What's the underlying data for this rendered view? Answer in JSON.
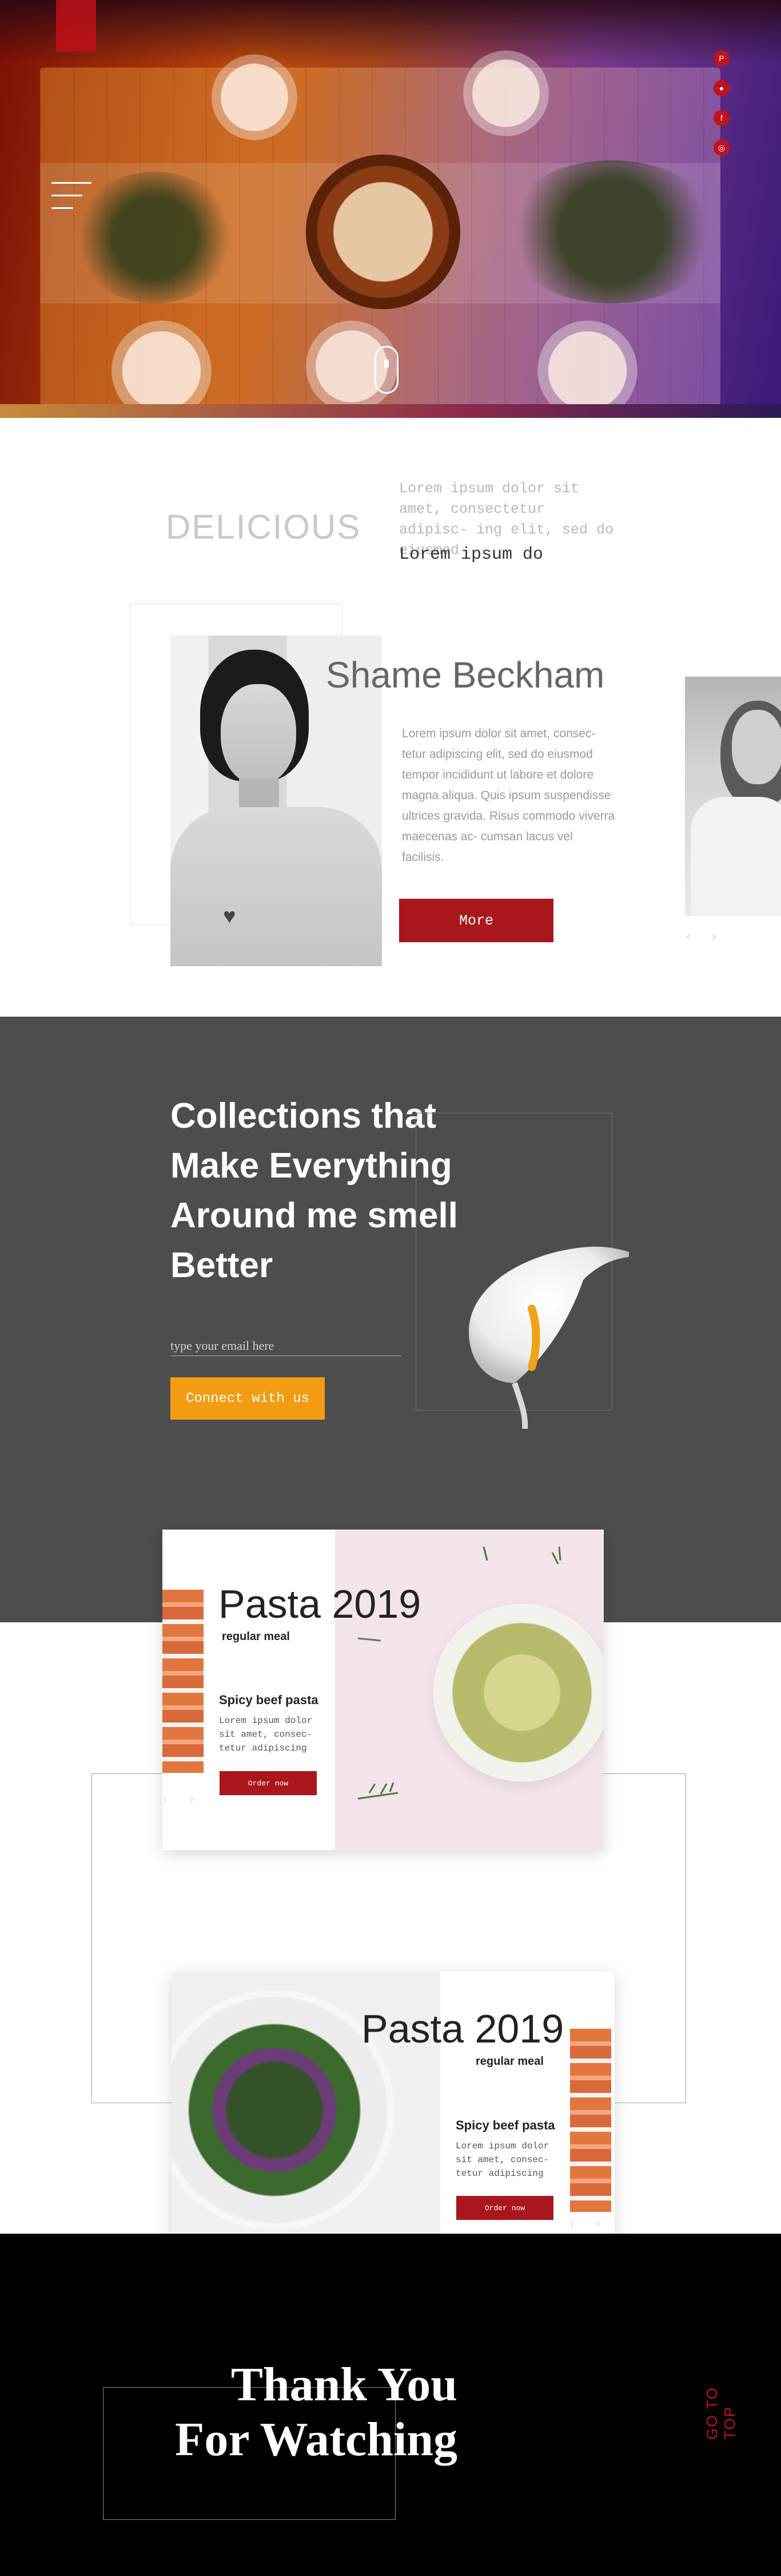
{
  "hero": {
    "social_icons": [
      "pinterest-icon",
      "dribbble-icon",
      "facebook-icon",
      "instagram-icon"
    ],
    "accent_color": "#c1131f"
  },
  "about": {
    "heading": "DELICIOUS",
    "intro_text": "Lorem ipsum dolor sit amet, consectetur adipisc- ing elit, sed do eiusmod",
    "intro_subtext": "Lorem ipsum do",
    "name": "Shame Beckham",
    "description": "Lorem ipsum dolor sit amet, consec- tetur adipiscing elit, sed do eiusmod tempor incididunt ut labore et dolore magna aliqua. Quis ipsum suspendisse ultrices gravida. Risus commodo viverra maecenas ac- cumsan lacus vel facilisis.",
    "more_label": "More",
    "prev_arrow": "‹",
    "next_arrow": "›"
  },
  "collections": {
    "title": "Collections that Make Everything Around me smell Better",
    "email_placeholder": "type your email here",
    "connect_label": "Connect with us"
  },
  "menu": {
    "cards": [
      {
        "title": "Pasta 2019",
        "subtitle": "regular meal",
        "dish": "Spicy beef pasta",
        "text": "Lorem ipsum dolor sit amet, consec- tetur adipiscing",
        "order_label": "Order now",
        "prev_arrow": "‹",
        "next_arrow": "›"
      },
      {
        "title": "Pasta 2019",
        "subtitle": "regular meal",
        "dish": "Spicy beef pasta",
        "text": "Lorem ipsum dolor sit amet, consec- tetur adipiscing",
        "order_label": "Order now",
        "prev_arrow": "‹",
        "next_arrow": "›"
      }
    ]
  },
  "footer": {
    "thanks_line1": "Thank You",
    "thanks_line2": "For Watching",
    "go_to_top": "GO TO TOP"
  }
}
